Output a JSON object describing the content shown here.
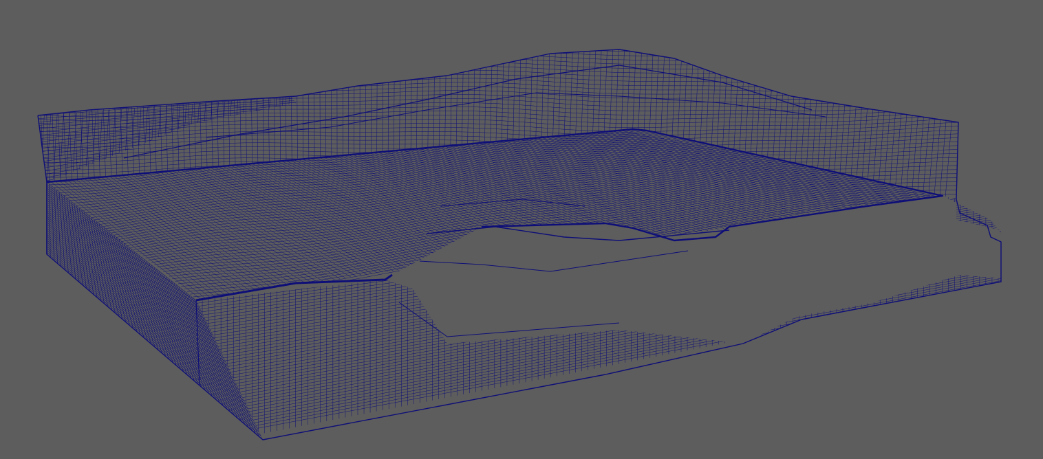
{
  "viewport": {
    "background_color": "#5d5d5d",
    "mesh_color": "#0e0e78",
    "display_mode": "wireframe"
  },
  "model": {
    "shape": "terrain block mesh",
    "icon": "wireframe-terrain-mesh"
  }
}
